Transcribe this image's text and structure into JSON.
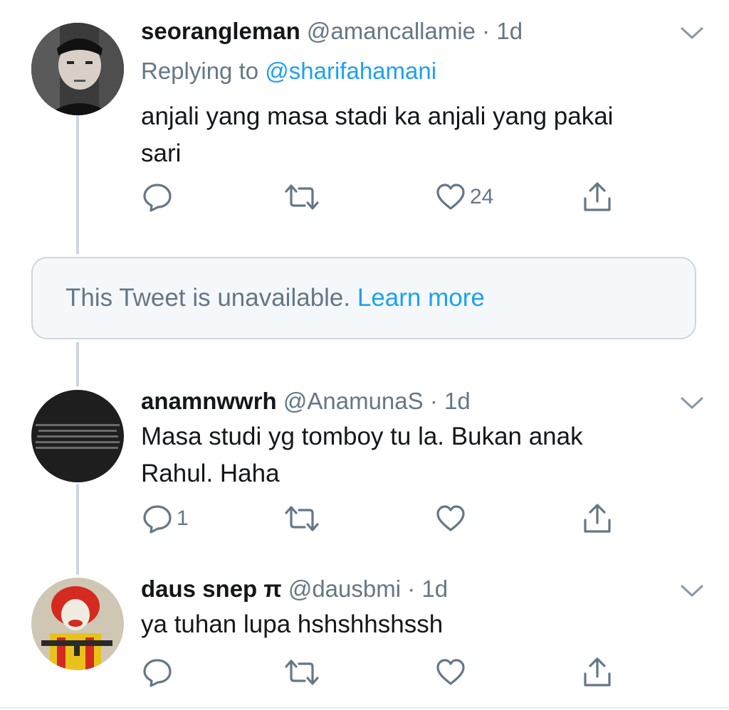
{
  "tweets": [
    {
      "name": "seorangleman",
      "handle": "@amancallamie",
      "separator": " · ",
      "time": "1d",
      "replying_label": "Replying to ",
      "replying_to": "@sharifahamani",
      "text_line1": "anjali yang masa stadi ka anjali yang pakai",
      "text_line2": "sari",
      "reply_count": "",
      "retweet_count": "",
      "like_count": "24"
    },
    {
      "name": "anamnwwrh",
      "handle": "@AnamunaS",
      "separator": " · ",
      "time": "1d",
      "text_line1": "Masa studi yg tomboy tu la. Bukan anak",
      "text_line2": "Rahul. Haha",
      "reply_count": "1",
      "retweet_count": "",
      "like_count": ""
    },
    {
      "name": "daus snep π",
      "handle": "@dausbmi",
      "separator": " · ",
      "time": "1d",
      "text_line1": "ya tuhan lupa hshshhshssh",
      "reply_count": "",
      "retweet_count": "",
      "like_count": ""
    }
  ],
  "unavailable": {
    "message": "This Tweet is unavailable. ",
    "link": "Learn more"
  },
  "icons": {
    "reply": "reply-icon",
    "retweet": "retweet-icon",
    "like": "heart-icon",
    "share": "share-icon",
    "more": "chevron-down-icon"
  },
  "colors": {
    "link": "#1da1f2",
    "secondary": "#657786",
    "primary": "#14171a",
    "thread_line": "#ccd6dd",
    "icon": "#657786"
  }
}
